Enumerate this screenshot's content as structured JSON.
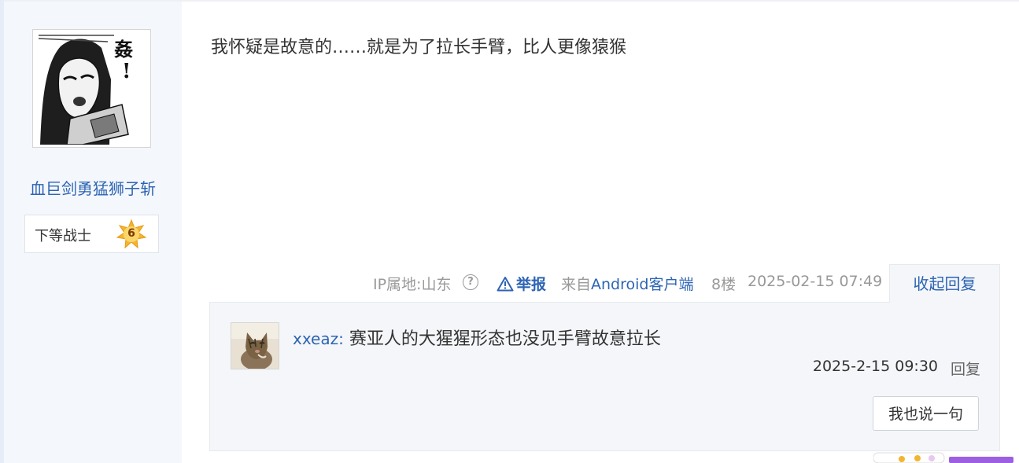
{
  "author": {
    "name": "血巨剑勇猛狮子斩",
    "rank_title": "下等战士",
    "rank_level": "6"
  },
  "post": {
    "content": "我怀疑是故意的……就是为了拉长手臂，比人更像猿猴"
  },
  "meta": {
    "ip_location": "IP属地:山东",
    "help_icon_glyph": "?",
    "report_label": "举报",
    "from_prefix": "来自",
    "client_label": "Android客户端",
    "floor": "8楼",
    "post_time": "2025-02-15 07:49",
    "collapse_label": "收起回复"
  },
  "reply": {
    "username": "xxeaz",
    "separator": ":",
    "content": " 赛亚人的大猩猩形态也没见手臂故意拉长",
    "time": "2025-2-15 09:30",
    "reply_label": "回复"
  },
  "actions": {
    "say_one_label": "我也说一句"
  },
  "colors": {
    "link_blue": "#2d64b3",
    "sidebar_bg": "#f4f7fc",
    "reply_bg": "#f4f6f9",
    "badge_gold": "#f3b531"
  },
  "icons": {
    "help": "question-circle-icon",
    "report": "warning-triangle-icon",
    "rank": "star-badge-icon"
  }
}
